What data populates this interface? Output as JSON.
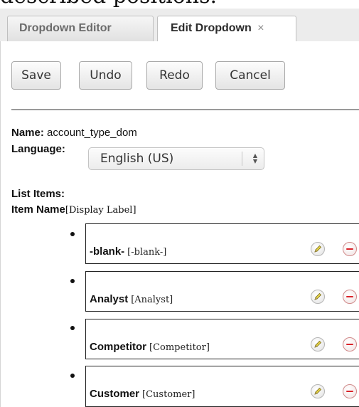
{
  "top_text": "described positions.",
  "tabs": [
    {
      "label": "Dropdown Editor",
      "close": ""
    },
    {
      "label": "Edit Dropdown",
      "close": "×"
    }
  ],
  "toolbar": {
    "save": "Save",
    "undo": "Undo",
    "redo": "Redo",
    "cancel": "Cancel"
  },
  "form": {
    "name_label": "Name:",
    "name_value": "account_type_dom",
    "language_label": "Language:",
    "language_value": "English (US)",
    "list_items_label": "List Items:",
    "item_name_header": "Item Name",
    "display_label_header": "[Display Label]"
  },
  "items": [
    {
      "name": "-blank-",
      "display": "[-blank-]"
    },
    {
      "name": "Analyst",
      "display": "[Analyst]"
    },
    {
      "name": "Competitor",
      "display": "[Competitor]"
    },
    {
      "name": "Customer",
      "display": "[Customer]"
    }
  ],
  "icons": {
    "edit": "pencil-icon",
    "remove": "minus-circle-icon",
    "select": "up-down-arrows-icon"
  }
}
